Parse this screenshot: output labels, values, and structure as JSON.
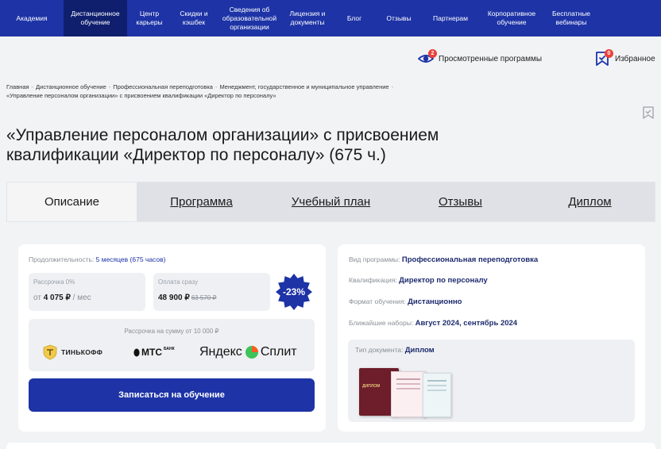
{
  "nav": [
    {
      "label": "Академия",
      "active": false
    },
    {
      "label": "Дистанционное обучение",
      "active": true
    },
    {
      "label": "Центр карьеры",
      "active": false
    },
    {
      "label": "Скидки и кэшбек",
      "active": false
    },
    {
      "label": "Сведения об образовательной организации",
      "active": false
    },
    {
      "label": "Лицензия и документы",
      "active": false
    },
    {
      "label": "Блог",
      "active": false
    },
    {
      "label": "Отзывы",
      "active": false
    },
    {
      "label": "Партнерам",
      "active": false
    },
    {
      "label": "Корпоративное обучение",
      "active": false
    },
    {
      "label": "Бесплатные вебинары",
      "active": false
    }
  ],
  "utility": {
    "viewed_label": "Просмотренные программы",
    "viewed_count": "2",
    "favorites_label": "Избранное",
    "favorites_count": "0"
  },
  "breadcrumbs": [
    "Главная",
    "Дистанционное обучение",
    "Профессиональная переподготовка",
    "Менеджмент, государственное и муниципальное управление",
    "«Управление персоналом организации» с присвоением квалификации «Директор по персоналу»"
  ],
  "page_title": "«Управление персоналом организации» с присвоением квалификации «Директор по персоналу» (675 ч.)",
  "tabs": [
    {
      "label": "Описание",
      "active": true
    },
    {
      "label": "Программа",
      "active": false
    },
    {
      "label": "Учебный план",
      "active": false
    },
    {
      "label": "Отзывы",
      "active": false
    },
    {
      "label": "Диплом",
      "active": false
    }
  ],
  "pricing": {
    "duration_label": "Продолжительность:",
    "duration_value": "5 месяцев (675 часов)",
    "installment_label": "Рассрочка 0%",
    "installment_prefix": "от",
    "installment_value": "4 075 ₽",
    "installment_suffix": "/ мес",
    "full_label": "Оплата сразу",
    "full_value": "48 900 ₽",
    "full_old": "63 570 ₽",
    "discount": "-23%",
    "partners_heading": "Рассрочка на сумму от 10 000 ₽",
    "partner_tinkoff": "ТИНЬКОФФ",
    "partner_mts": "МТС",
    "partner_mts_sub": "БАНК",
    "partner_yandex": "Яндекс",
    "partner_split": "Сплит",
    "enroll_button": "Записаться на обучение"
  },
  "info": {
    "program_type_label": "Вид программы:",
    "program_type_value": "Профессиональная переподготовка",
    "qualification_label": "Квалификация:",
    "qualification_value": "Директор по персоналу",
    "format_label": "Формат обучения:",
    "format_value": "Дистанционно",
    "enrollment_label": "Ближайшие наборы:",
    "enrollment_value": "Август 2024, сентябрь 2024",
    "doc_type_label": "Тип документа:",
    "doc_type_value": "Диплом",
    "diploma_cover_text": "ДИПЛОМ"
  },
  "colors": {
    "brand_blue": "#1d33a6",
    "nav_active": "#0f1f6e",
    "badge_red": "#e9423a",
    "page_bg": "#f2f3f5"
  }
}
